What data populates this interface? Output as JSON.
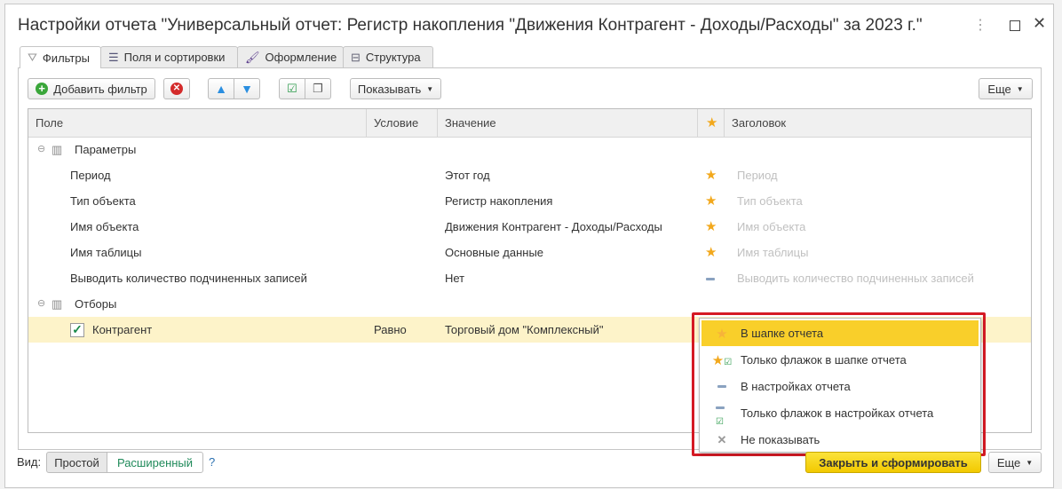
{
  "window": {
    "title": "Настройки отчета \"Универсальный отчет: Регистр накопления \"Движения Контрагент - Доходы/Расходы\" за 2023 г.\""
  },
  "tabs": [
    {
      "label": "Фильтры"
    },
    {
      "label": "Поля и сортировки"
    },
    {
      "label": "Оформление"
    },
    {
      "label": "Структура"
    }
  ],
  "toolbar": {
    "add_filter": "Добавить фильтр",
    "show": "Показывать",
    "more": "Еще"
  },
  "table": {
    "headers": {
      "field": "Поле",
      "condition": "Условие",
      "value": "Значение",
      "title": "Заголовок"
    },
    "groups": [
      {
        "name": "Параметры",
        "rows": [
          {
            "field": "Период",
            "condition": "",
            "value": "Этот год",
            "mode": "star",
            "title": "Период"
          },
          {
            "field": "Тип объекта",
            "condition": "",
            "value": "Регистр накопления",
            "mode": "star",
            "title": "Тип объекта"
          },
          {
            "field": "Имя объекта",
            "condition": "",
            "value": "Движения Контрагент - Доходы/Расходы",
            "mode": "star",
            "title": "Имя объекта"
          },
          {
            "field": "Имя таблицы",
            "condition": "",
            "value": "Основные данные",
            "mode": "star",
            "title": "Имя таблицы"
          },
          {
            "field": "Выводить количество подчиненных записей",
            "condition": "",
            "value": "Нет",
            "mode": "dash",
            "title": "Выводить количество подчиненных записей"
          }
        ]
      },
      {
        "name": "Отборы",
        "rows": [
          {
            "field": "Контрагент",
            "checked": true,
            "condition": "Равно",
            "value": "Торговый дом \"Комплексный\""
          }
        ]
      }
    ]
  },
  "dropdown": {
    "items": [
      {
        "label": "В шапке отчета",
        "icon": "star-icon",
        "selected": true
      },
      {
        "label": "Только флажок в шапке отчета",
        "icon": "star-check-icon"
      },
      {
        "label": "В настройках отчета",
        "icon": "dash-icon"
      },
      {
        "label": "Только флажок в настройках отчета",
        "icon": "dash-check-icon"
      },
      {
        "label": "Не показывать",
        "icon": "cross-icon"
      }
    ]
  },
  "footer": {
    "view_label": "Вид:",
    "simple": "Простой",
    "extended": "Расширенный",
    "help": "?",
    "close_generate": "Закрыть и сформировать",
    "more": "Еще"
  },
  "colors": {
    "accent_yellow": "#f9cf2a",
    "selection_row": "#fdf3c9",
    "highlight_frame": "#d51a24",
    "star": "#f2a81c"
  }
}
